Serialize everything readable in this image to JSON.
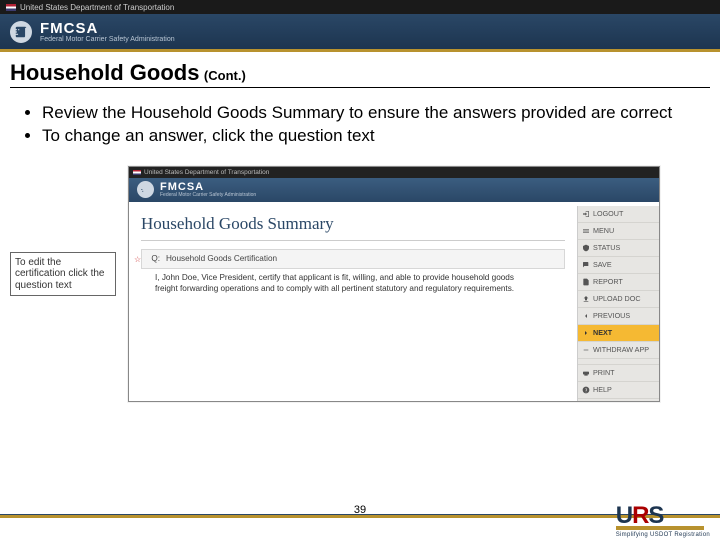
{
  "gov_header": "United States Department of Transportation",
  "agency": {
    "name": "FMCSA",
    "sub": "Federal Motor Carrier Safety Administration"
  },
  "slide": {
    "title": "Household Goods",
    "title_suffix": "(Cont.)",
    "bullets": [
      "Review the Household Goods Summary to ensure the answers provided are correct",
      "To change an answer, click the question text"
    ],
    "callout": "To edit the certification click the question text"
  },
  "screenshot": {
    "gov_header": "United States Department of Transportation",
    "summary_title": "Household Goods Summary",
    "section": {
      "q": "Q:",
      "label": "Household Goods Certification"
    },
    "certification": "I, John Doe, Vice President, certify that applicant is fit, willing, and able to provide household goods freight forwarding operations and to comply with all pertinent statutory and regulatory requirements.",
    "sidebar": [
      {
        "icon": "logout",
        "label": "LOGOUT"
      },
      {
        "icon": "menu",
        "label": "MENU"
      },
      {
        "icon": "status",
        "label": "STATUS"
      },
      {
        "icon": "save",
        "label": "SAVE"
      },
      {
        "icon": "report",
        "label": "REPORT"
      },
      {
        "icon": "upload",
        "label": "UPLOAD DOC"
      },
      {
        "icon": "prev",
        "label": "PREVIOUS"
      },
      {
        "icon": "next",
        "label": "NEXT",
        "highlight": true
      },
      {
        "icon": "withdraw",
        "label": "WITHDRAW APP"
      },
      {
        "icon": "print",
        "label": "PRINT"
      },
      {
        "icon": "help",
        "label": "HELP"
      }
    ]
  },
  "footer": {
    "page": "39",
    "urs": "URS",
    "urs_sub": "Simplifying USDOT Registration"
  }
}
